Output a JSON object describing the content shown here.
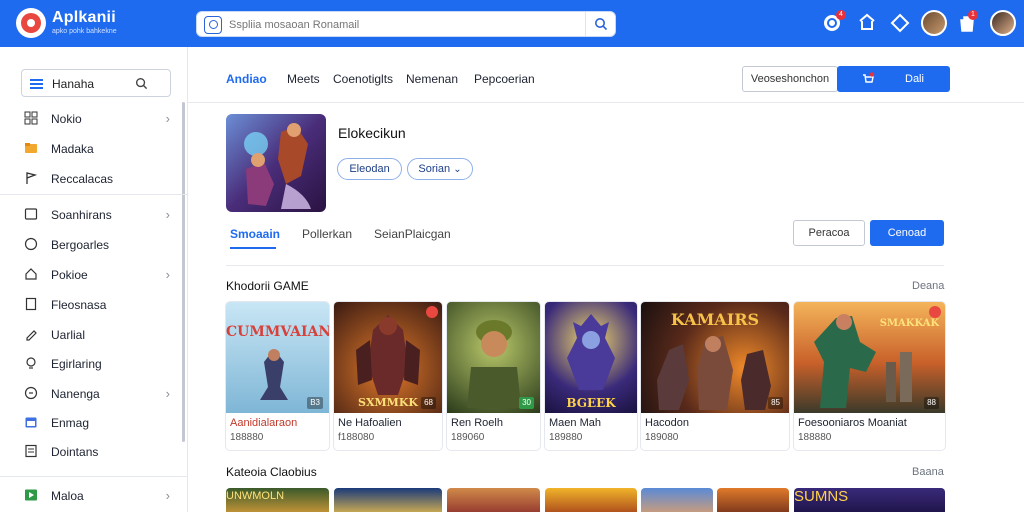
{
  "app": {
    "name": "Aplkanii",
    "tagline": "apko pohk bahkekne"
  },
  "search": {
    "placeholder": "Sspliia mosaoan Ronamail"
  },
  "topbar": {
    "icons": [
      "shield-icon",
      "cart-icon",
      "gift-icon",
      "user-avatar",
      "bag-icon",
      "user-avatar"
    ],
    "notif_a": "4",
    "notif_b": "1"
  },
  "sidebar": {
    "search_label": "Hanaha",
    "items": [
      {
        "label": "Nokio",
        "icon": "grid-icon",
        "chevron": true
      },
      {
        "label": "Madaka",
        "icon": "folder-icon",
        "chevron": false
      },
      {
        "label": "Reccalacas",
        "icon": "flag-icon",
        "chevron": false
      },
      {
        "label": "Soanhirans",
        "icon": "window-icon",
        "chevron": true
      },
      {
        "label": "Bergoarles",
        "icon": "circle-icon",
        "chevron": false
      },
      {
        "label": "Pokioe",
        "icon": "home-icon",
        "chevron": true
      },
      {
        "label": "Fleosnasa",
        "icon": "document-icon",
        "chevron": false
      },
      {
        "label": "Uarlial",
        "icon": "pencil-icon",
        "chevron": false
      },
      {
        "label": "Egirlaring",
        "icon": "bulb-icon",
        "chevron": false
      },
      {
        "label": "Nanenga",
        "icon": "info-icon",
        "chevron": true
      },
      {
        "label": "Enmag",
        "icon": "calendar-icon",
        "chevron": false
      },
      {
        "label": "Dointans",
        "icon": "sheet-icon",
        "chevron": false
      },
      {
        "label": "Maloa",
        "icon": "play-icon",
        "chevron": true
      }
    ]
  },
  "main": {
    "tabs": [
      "Andiao",
      "Meets",
      "Coenotiglts",
      "Nemenan",
      "Pepcoerian"
    ],
    "header_buttons": {
      "outline": "Veoseshonchon",
      "primary": "Dali"
    },
    "app_title": "Elokecikun",
    "pills": {
      "first": "Eleodan",
      "second": "Sorian"
    },
    "subtabs": [
      "Smoaain",
      "Pollerkan",
      "SeianPlaicgan"
    ],
    "action_buttons": {
      "outline": "Peracoa",
      "primary": "Cenoad"
    },
    "section1": {
      "title": "Khodorii GAME",
      "link": "Deana",
      "cards": [
        {
          "name": "Aanidialaraon",
          "meta": "188880",
          "thumb_title": "CUMMVAIAN",
          "badge": "B3"
        },
        {
          "name": "Ne Hafoalien",
          "meta": "f188080",
          "thumb_title": "SXMMKK",
          "badge": "68"
        },
        {
          "name": "Ren Roelh",
          "meta": "189060",
          "thumb_title": "",
          "badge": "30"
        },
        {
          "name": "Maen Mah",
          "meta": "189880",
          "thumb_title": "BGEEK",
          "badge": ""
        },
        {
          "name": "Hacodon",
          "meta": "189080",
          "thumb_title": "KAMAIRS",
          "badge": "85"
        },
        {
          "name": "Foesooniaros Moaniat",
          "meta": "188880",
          "thumb_title": "SMAKKAK",
          "badge": "88"
        }
      ]
    },
    "section2": {
      "title": "Kateoia Claobius",
      "link": "Baana",
      "thumbs": [
        "UNWMOLN",
        "",
        "",
        "",
        "",
        "",
        "SUMNS"
      ]
    }
  },
  "colors": {
    "accent": "#1f6bf0",
    "topbar": "#1f6bf0",
    "notification": "#e8313a"
  }
}
